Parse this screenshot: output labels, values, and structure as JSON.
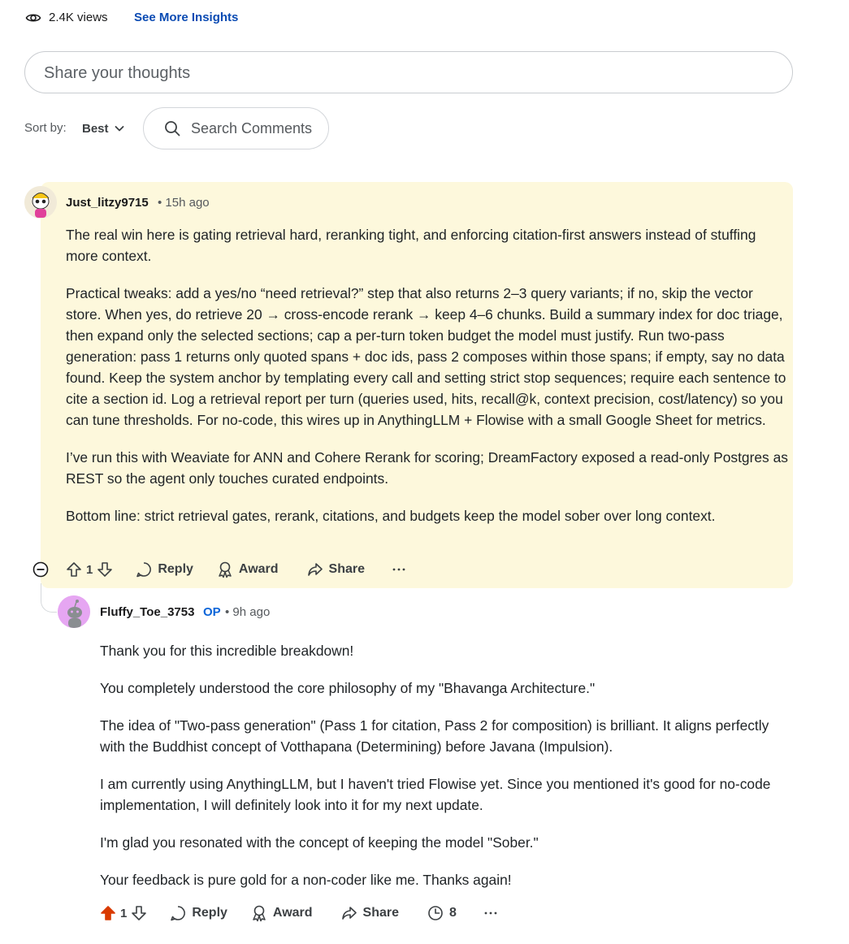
{
  "insights": {
    "views": "2.4K views",
    "see_more": "See More Insights"
  },
  "composer": {
    "placeholder": "Share your thoughts"
  },
  "sort": {
    "label": "Sort by:",
    "value": "Best"
  },
  "search": {
    "placeholder": "Search Comments"
  },
  "comments": [
    {
      "author": "Just_litzy9715",
      "time": "• 15h ago",
      "paragraphs": [
        "The real win here is gating retrieval hard, reranking tight, and enforcing citation-first answers instead of stuffing more context.",
        "Practical tweaks: add a yes/no “need retrieval?” step that also returns 2–3 query variants; if no, skip the vector store. When yes, do retrieve 20 → cross-encode rerank → keep 4–6 chunks. Build a summary index for doc triage, then expand only the selected sections; cap a per-turn token budget the model must justify. Run two-pass generation: pass 1 returns only quoted spans + doc ids, pass 2 composes within those spans; if empty, say no data found. Keep the system anchor by templating every call and setting strict stop sequences; require each sentence to cite a section id. Log a retrieval report per turn (queries used, hits, recall@k, context precision, cost/latency) so you can tune thresholds. For no-code, this wires up in AnythingLLM + Flowise with a small Google Sheet for metrics.",
        "I’ve run this with Weaviate for ANN and Cohere Rerank for scoring; DreamFactory exposed a read-only Postgres as REST so the agent only touches curated endpoints.",
        "Bottom line: strict retrieval gates, rerank, citations, and budgets keep the model sober over long context."
      ],
      "votes": "1",
      "actions": {
        "reply": "Reply",
        "award": "Award",
        "share": "Share"
      }
    },
    {
      "author": "Fluffy_Toe_3753",
      "op_badge": "OP",
      "time": "• 9h ago",
      "paragraphs": [
        "Thank you for this incredible breakdown!",
        "You completely understood the core philosophy of my \"Bhavanga Architecture.\"",
        "The idea of \"Two-pass generation\" (Pass 1 for citation, Pass 2 for composition) is brilliant. It aligns perfectly with the Buddhist concept of Votthapana (Determining) before Javana (Impulsion).",
        "I am currently using AnythingLLM, but I haven't tried Flowise yet. Since you mentioned it's good for no-code implementation, I will definitely look into it for my next update.",
        "I'm glad you resonated with the concept of keeping the model \"Sober.\"",
        "Your feedback is pure gold for a non-coder like me. Thanks again!"
      ],
      "votes": "1",
      "upvoted": true,
      "actions": {
        "reply": "Reply",
        "award": "Award",
        "share": "Share",
        "insights_count": "8"
      }
    }
  ],
  "colors": {
    "highlight_bg": "#fdf8dc",
    "link": "#0b4bb3",
    "op": "#0b64d8",
    "upvote_active": "#d93a00"
  },
  "icons": [
    "eye-icon",
    "chevron-down-icon",
    "search-icon",
    "collapse-icon",
    "upvote-icon",
    "downvote-icon",
    "reply-icon",
    "award-icon",
    "share-icon",
    "insights-icon",
    "more-icon"
  ]
}
